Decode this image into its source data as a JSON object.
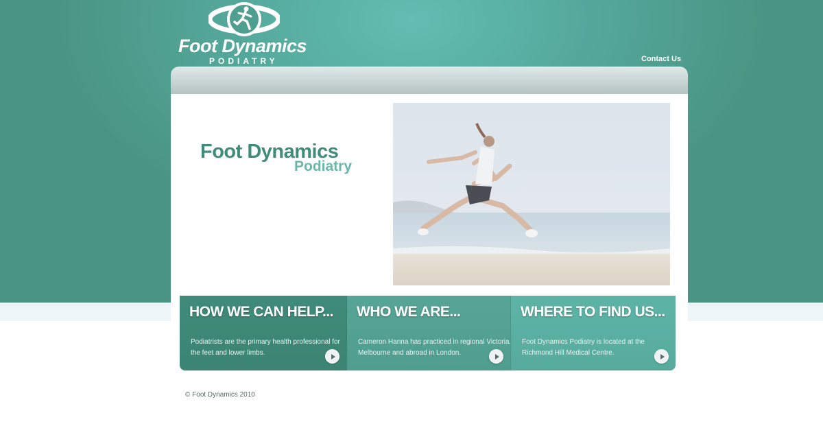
{
  "header": {
    "logo_title": "Foot Dynamics",
    "logo_subtitle": "PODIATRY",
    "contact_link": "Contact Us"
  },
  "hero": {
    "brand_title": "Foot Dynamics",
    "brand_subtitle": "Podiatry"
  },
  "features": [
    {
      "heading": "HOW WE CAN HELP...",
      "text": "Podiatrists are the primary health professional for the feet and lower limbs."
    },
    {
      "heading": "WHO WE ARE...",
      "text": "Cameron Hanna has practiced in regional Victoria, Melbourne and abroad in London."
    },
    {
      "heading": "WHERE TO FIND US...",
      "text": "Foot Dynamics Podiatry is located at the Richmond Hill Medical Centre."
    }
  ],
  "footer": {
    "copyright": "© Foot Dynamics 2010"
  },
  "colors": {
    "teal_dark": "#3f8b79",
    "teal_mid": "#56a596",
    "teal_light": "#5db4a6",
    "brand_text": "#3f8c7a"
  }
}
